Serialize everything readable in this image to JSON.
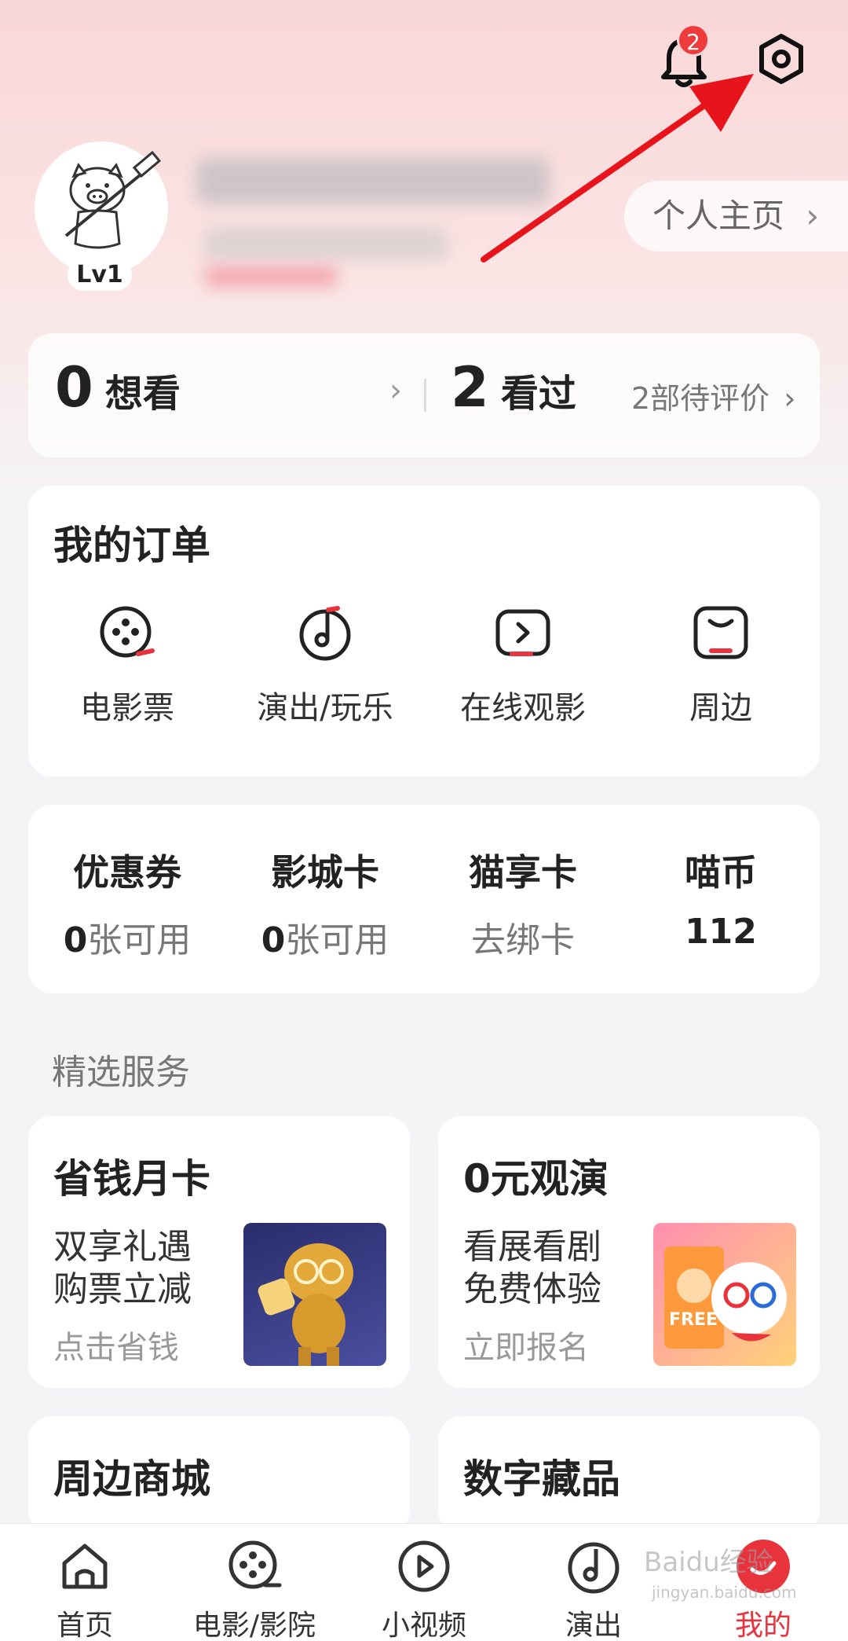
{
  "header": {
    "notification_count": "2",
    "icons": [
      "bell-icon",
      "settings-gear-icon"
    ]
  },
  "profile": {
    "level": "Lv1",
    "homepage_label": "个人主页",
    "homepage_chevron": "›"
  },
  "stats": {
    "want_count": "0",
    "want_label": "想看",
    "want_chevron": "›",
    "watched_count": "2",
    "watched_label": "看过",
    "pending_review": "2部待评价",
    "pending_chevron": "›"
  },
  "orders": {
    "title": "我的订单",
    "items": [
      {
        "label": "电影票",
        "icon": "film-reel-icon"
      },
      {
        "label": "演出/玩乐",
        "icon": "music-disc-icon"
      },
      {
        "label": "在线观影",
        "icon": "play-screen-icon"
      },
      {
        "label": "周边",
        "icon": "shopping-bag-icon"
      }
    ]
  },
  "wallet": {
    "items": [
      {
        "title": "优惠券",
        "num": "0",
        "suffix": "张可用"
      },
      {
        "title": "影城卡",
        "num": "0",
        "suffix": "张可用"
      },
      {
        "title": "猫享卡",
        "num": "",
        "suffix": "去绑卡"
      },
      {
        "title": "喵币",
        "num": "112",
        "suffix": ""
      }
    ]
  },
  "services": {
    "section_title": "精选服务",
    "cards": [
      {
        "title": "省钱月卡",
        "line1": "双享礼遇",
        "line2": "购票立减",
        "link": "点击省钱"
      },
      {
        "title": "0元观演",
        "line1": "看展看剧",
        "line2": "免费体验",
        "link": "立即报名",
        "image_text": "FREE"
      },
      {
        "title": "周边商城"
      },
      {
        "title": "数字藏品"
      }
    ]
  },
  "bottom_nav": {
    "items": [
      {
        "label": "首页",
        "icon": "home-icon"
      },
      {
        "label": "电影/影院",
        "icon": "film-reel-icon"
      },
      {
        "label": "小视频",
        "icon": "play-circle-icon"
      },
      {
        "label": "演出",
        "icon": "music-disc-icon"
      },
      {
        "label": "我的",
        "icon": "profile-icon"
      }
    ]
  },
  "watermark": {
    "text": "Baidu经验",
    "url_text": "jingyan.baidu.com"
  },
  "colors": {
    "accent": "#e8323c",
    "badge": "#ef3b3b",
    "arrow": "#e8141c"
  }
}
